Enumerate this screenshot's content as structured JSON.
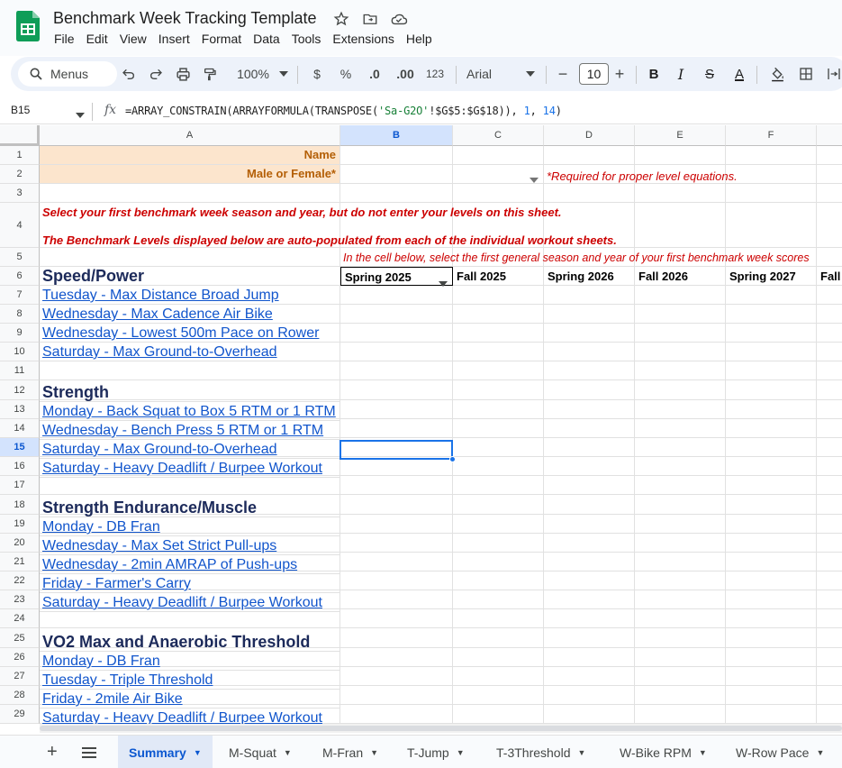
{
  "document": {
    "title": "Benchmark Week Tracking Template",
    "menu": [
      "File",
      "Edit",
      "View",
      "Insert",
      "Format",
      "Data",
      "Tools",
      "Extensions",
      "Help"
    ]
  },
  "toolbar": {
    "search_label": "Menus",
    "zoom": "100%",
    "currency": "$",
    "percent": "%",
    "dec_decrease": ".0",
    "dec_increase": ".00",
    "number_format": "123",
    "font": "Arial",
    "font_size": "10",
    "minus": "−",
    "plus": "+",
    "bold": "B",
    "italic": "I",
    "strike": "S",
    "text_color": "A"
  },
  "formula_bar": {
    "name_box": "B15",
    "fx": "fx",
    "formula_prefix": "=ARRAY_CONSTRAIN(ARRAYFORMULA(TRANSPOSE(",
    "formula_string": "'Sa-G2O'",
    "formula_middle": "!$G$5:$G$18)), ",
    "formula_num1": "1",
    "formula_comma": ", ",
    "formula_num2": "14",
    "formula_suffix": ")"
  },
  "columns": [
    "A",
    "B",
    "C",
    "D",
    "E",
    "F"
  ],
  "rows": [
    "1",
    "2",
    "3",
    "4",
    "5",
    "6",
    "7",
    "8",
    "9",
    "10",
    "11",
    "12",
    "13",
    "14",
    "15",
    "16",
    "17",
    "18",
    "19",
    "20",
    "21",
    "22",
    "23",
    "24",
    "25",
    "26",
    "27",
    "28",
    "29"
  ],
  "sheet": {
    "name_label": "Name",
    "gender_label": "Male or Female*",
    "required_note": "*Required for proper level equations.",
    "instruction_1": "Select your first benchmark week season and year, but do not enter your levels on this sheet.",
    "instruction_2": "The Benchmark Levels displayed below are auto-populated from each of the individual workout sheets.",
    "season_note": "In the cell below, select the first general season and year of your first benchmark week scores",
    "seasons": [
      "Spring 2025",
      "Fall 2025",
      "Spring 2026",
      "Fall 2026",
      "Spring 2027",
      "Fall"
    ],
    "sections": {
      "speed": "Speed/Power",
      "strength": "Strength",
      "endurance": "Strength Endurance/Muscle",
      "vo2": "VO2 Max and Anaerobic Threshold"
    },
    "speed_items": [
      "Tuesday - Max Distance Broad Jump",
      "Wednesday - Max Cadence Air Bike",
      "Wednesday - Lowest 500m Pace on Rower",
      "Saturday - Max Ground-to-Overhead"
    ],
    "strength_items": [
      "Monday - Back Squat to Box 5 RTM or 1 RTM",
      "Wednesday - Bench Press 5 RTM or 1 RTM",
      "Saturday - Max Ground-to-Overhead",
      "Saturday - Heavy Deadlift / Burpee Workout"
    ],
    "endurance_items": [
      "Monday - DB Fran",
      "Wednesday - Max Set Strict Pull-ups",
      "Wednesday - 2min AMRAP of Push-ups",
      "Friday - Farmer's Carry",
      "Saturday - Heavy Deadlift / Burpee Workout"
    ],
    "vo2_items": [
      "Monday - DB Fran",
      "Tuesday - Triple Threshold",
      "Friday - 2mile Air Bike",
      "Saturday - Heavy Deadlift / Burpee Workout"
    ]
  },
  "tabs": {
    "add": "+",
    "list": "≡",
    "items": [
      "Summary",
      "M-Squat",
      "M-Fran",
      "T-Jump",
      "T-3Threshold",
      "W-Bike RPM",
      "W-Row Pace"
    ]
  },
  "colors": {
    "accent": "#1a73e8",
    "header_fill": "#fce5cd",
    "header_text": "#b45f06",
    "note_red": "#cc0000",
    "link_blue": "#1155cc",
    "logo_green": "#0f9d58"
  }
}
